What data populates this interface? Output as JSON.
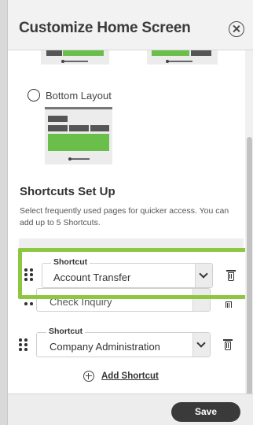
{
  "header": {
    "title": "Customize Home Screen"
  },
  "layouts": {
    "bottom_label": "Bottom Layout"
  },
  "shortcuts": {
    "title": "Shortcuts Set Up",
    "description": "Select frequently used pages for quicker access. You can add up to 5 Shortcuts.",
    "field_label": "Shortcut",
    "items": [
      {
        "label": "Shortcut",
        "value": "Account Transfer"
      },
      {
        "label": "Shortcut",
        "value": "Check Inquiry"
      },
      {
        "label": "Shortcut",
        "value": "Company Administration"
      }
    ],
    "add_label": "Add Shortcut"
  },
  "footer": {
    "save_label": "Save"
  },
  "colors": {
    "accent_green": "#6abf4b",
    "highlight_green": "#8dc63f",
    "button_dark": "#3a3a3a"
  }
}
